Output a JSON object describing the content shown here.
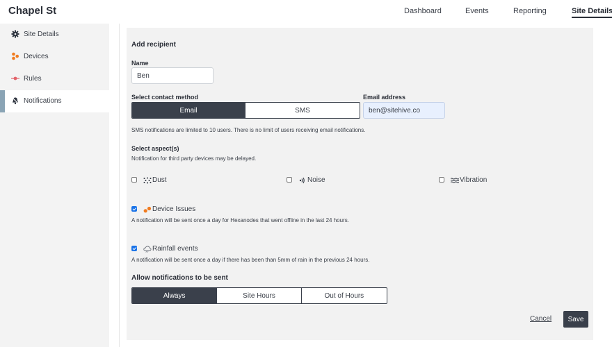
{
  "header": {
    "site_title": "Chapel St",
    "nav": [
      {
        "label": "Dashboard"
      },
      {
        "label": "Events"
      },
      {
        "label": "Reporting"
      },
      {
        "label": "Site Details",
        "active": true
      }
    ]
  },
  "sidebar": {
    "items": [
      {
        "label": "Site Details",
        "icon": "gear-icon"
      },
      {
        "label": "Devices",
        "icon": "devices-icon"
      },
      {
        "label": "Rules",
        "icon": "rules-icon"
      },
      {
        "label": "Notifications",
        "icon": "bell-icon",
        "active": true
      }
    ]
  },
  "form": {
    "title": "Add recipient",
    "name_label": "Name",
    "name_value": "Ben",
    "contact_method_label": "Select contact method",
    "contact_options": [
      {
        "label": "Email",
        "selected": true
      },
      {
        "label": "SMS",
        "selected": false
      }
    ],
    "email_label": "Email address",
    "email_value": "ben@sitehive.co",
    "sms_note": "SMS notifications are limited to 10 users. There is no limit of users receiving email notifications.",
    "aspects_label": "Select aspect(s)",
    "aspects_note": "Notification for third party devices may be delayed.",
    "aspects": [
      {
        "label": "Dust",
        "checked": false,
        "icon": "dust-icon"
      },
      {
        "label": "Noise",
        "checked": false,
        "icon": "noise-icon"
      },
      {
        "label": "Vibration",
        "checked": false,
        "icon": "vibration-icon"
      }
    ],
    "device_issues": {
      "label": "Device Issues",
      "checked": true,
      "icon": "device-issues-icon",
      "note": "A notification will be sent once a day for Hexanodes that went offline in the last 24 hours."
    },
    "rainfall": {
      "label": "Rainfall events",
      "checked": true,
      "icon": "rain-cloud-icon",
      "note": "A notification will be sent once a day if there has been than 5mm of rain in the previous 24 hours."
    },
    "schedule_label": "Allow notifications to be sent",
    "schedule_options": [
      {
        "label": "Always",
        "selected": true
      },
      {
        "label": "Site Hours",
        "selected": false
      },
      {
        "label": "Out of Hours",
        "selected": false
      }
    ],
    "cancel_label": "Cancel",
    "save_label": "Save"
  },
  "colors": {
    "accent_dark": "#3a404b",
    "devices_orange": "#f07b1f",
    "rules_red": "#e2636a",
    "email_fill": "#e8f0fe",
    "checkbox_blue": "#1a73e8"
  }
}
